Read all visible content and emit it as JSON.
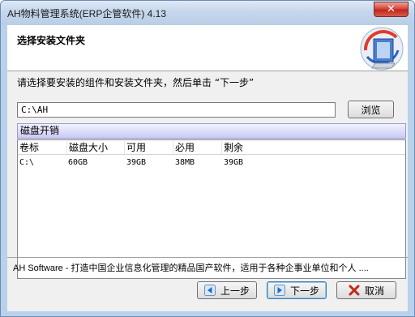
{
  "window": {
    "title": "AH物料管理系统(ERP企管软件) 4.13",
    "close_label": "✕"
  },
  "header": {
    "title": "选择安装文件夹"
  },
  "instruction": "请选择要安装的组件和安装文件夹，然后单击 “下一步”",
  "install_path": {
    "value": "C:\\AH"
  },
  "browse_label": "浏览",
  "disk_space": {
    "title": "磁盘开销",
    "columns": [
      "卷标",
      "磁盘大小",
      "可用",
      "必用",
      "剩余"
    ],
    "rows": [
      [
        "C:\\",
        "60GB",
        "39GB",
        "38MB",
        "39GB"
      ]
    ]
  },
  "footer_text": "AH Software - 打造中国企业信息化管理的精品国产软件，适用于各种企事业单位和个人 ....",
  "buttons": {
    "back": "上一步",
    "next": "下一步",
    "cancel": "取消"
  },
  "colors": {
    "accent": "#3c7fb1",
    "group_header": "#c9c9f4",
    "cancel_icon": "#c0281a",
    "nav_icon": "#1f6fc0"
  }
}
